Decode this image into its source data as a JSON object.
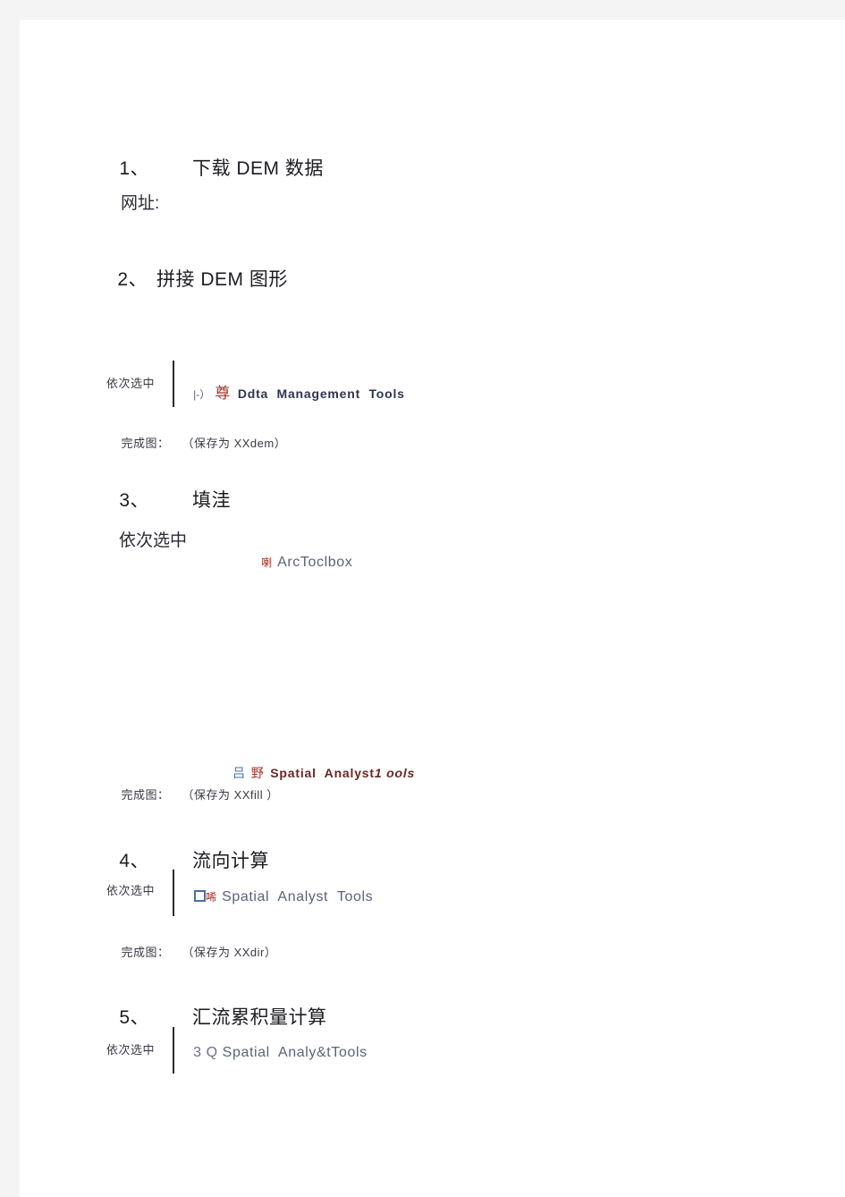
{
  "document": {
    "kind": "scanned-chinese-gis-tutorial",
    "page_background": "#ffffff",
    "scan_margin_color": "#f4f4f4",
    "text_color": "#1c1c22",
    "accent_red": "#a33228",
    "accent_maroon": "#6b2520",
    "accent_navy": "#2f3550",
    "accent_blue": "#4a6ea8"
  },
  "steps": [
    {
      "number": "1、",
      "title": "下载 DEM 数据",
      "body": "网址:"
    },
    {
      "number": "2、",
      "title": "拼接 DEM 图形",
      "select_label": "依次选中",
      "ui_prefix": "|-）",
      "ui_glyph": "尊",
      "ui_text": "Ddta  Management  Tools",
      "result_label": "完成图：",
      "result_value": "（保存为 XXdem）"
    },
    {
      "number": "3、",
      "title": "填洼",
      "select_label": "依次选中",
      "ui_glyph": "喇",
      "ui_text": "ArcToclbox",
      "ui2_glyph_a": "吕",
      "ui2_glyph_b": "野",
      "ui2_text": "Spatial  Analyst",
      "ui2_text_tail": "1 ools",
      "result_label": "完成图：",
      "result_value": "（保存为 XXfill ）"
    },
    {
      "number": "4、",
      "title": "流向计算",
      "select_label": "依次选中",
      "ui_glyph": "唏",
      "ui_text": "Spatial  Analyst  Tools",
      "result_label": "完成图：",
      "result_value": "（保存为 XXdir）"
    },
    {
      "number": "5、",
      "title": "汇流累积量计算",
      "select_label": "依次选中",
      "ui_prefix": "3 Q",
      "ui_text": "Spatial  Analy&tTools"
    }
  ]
}
